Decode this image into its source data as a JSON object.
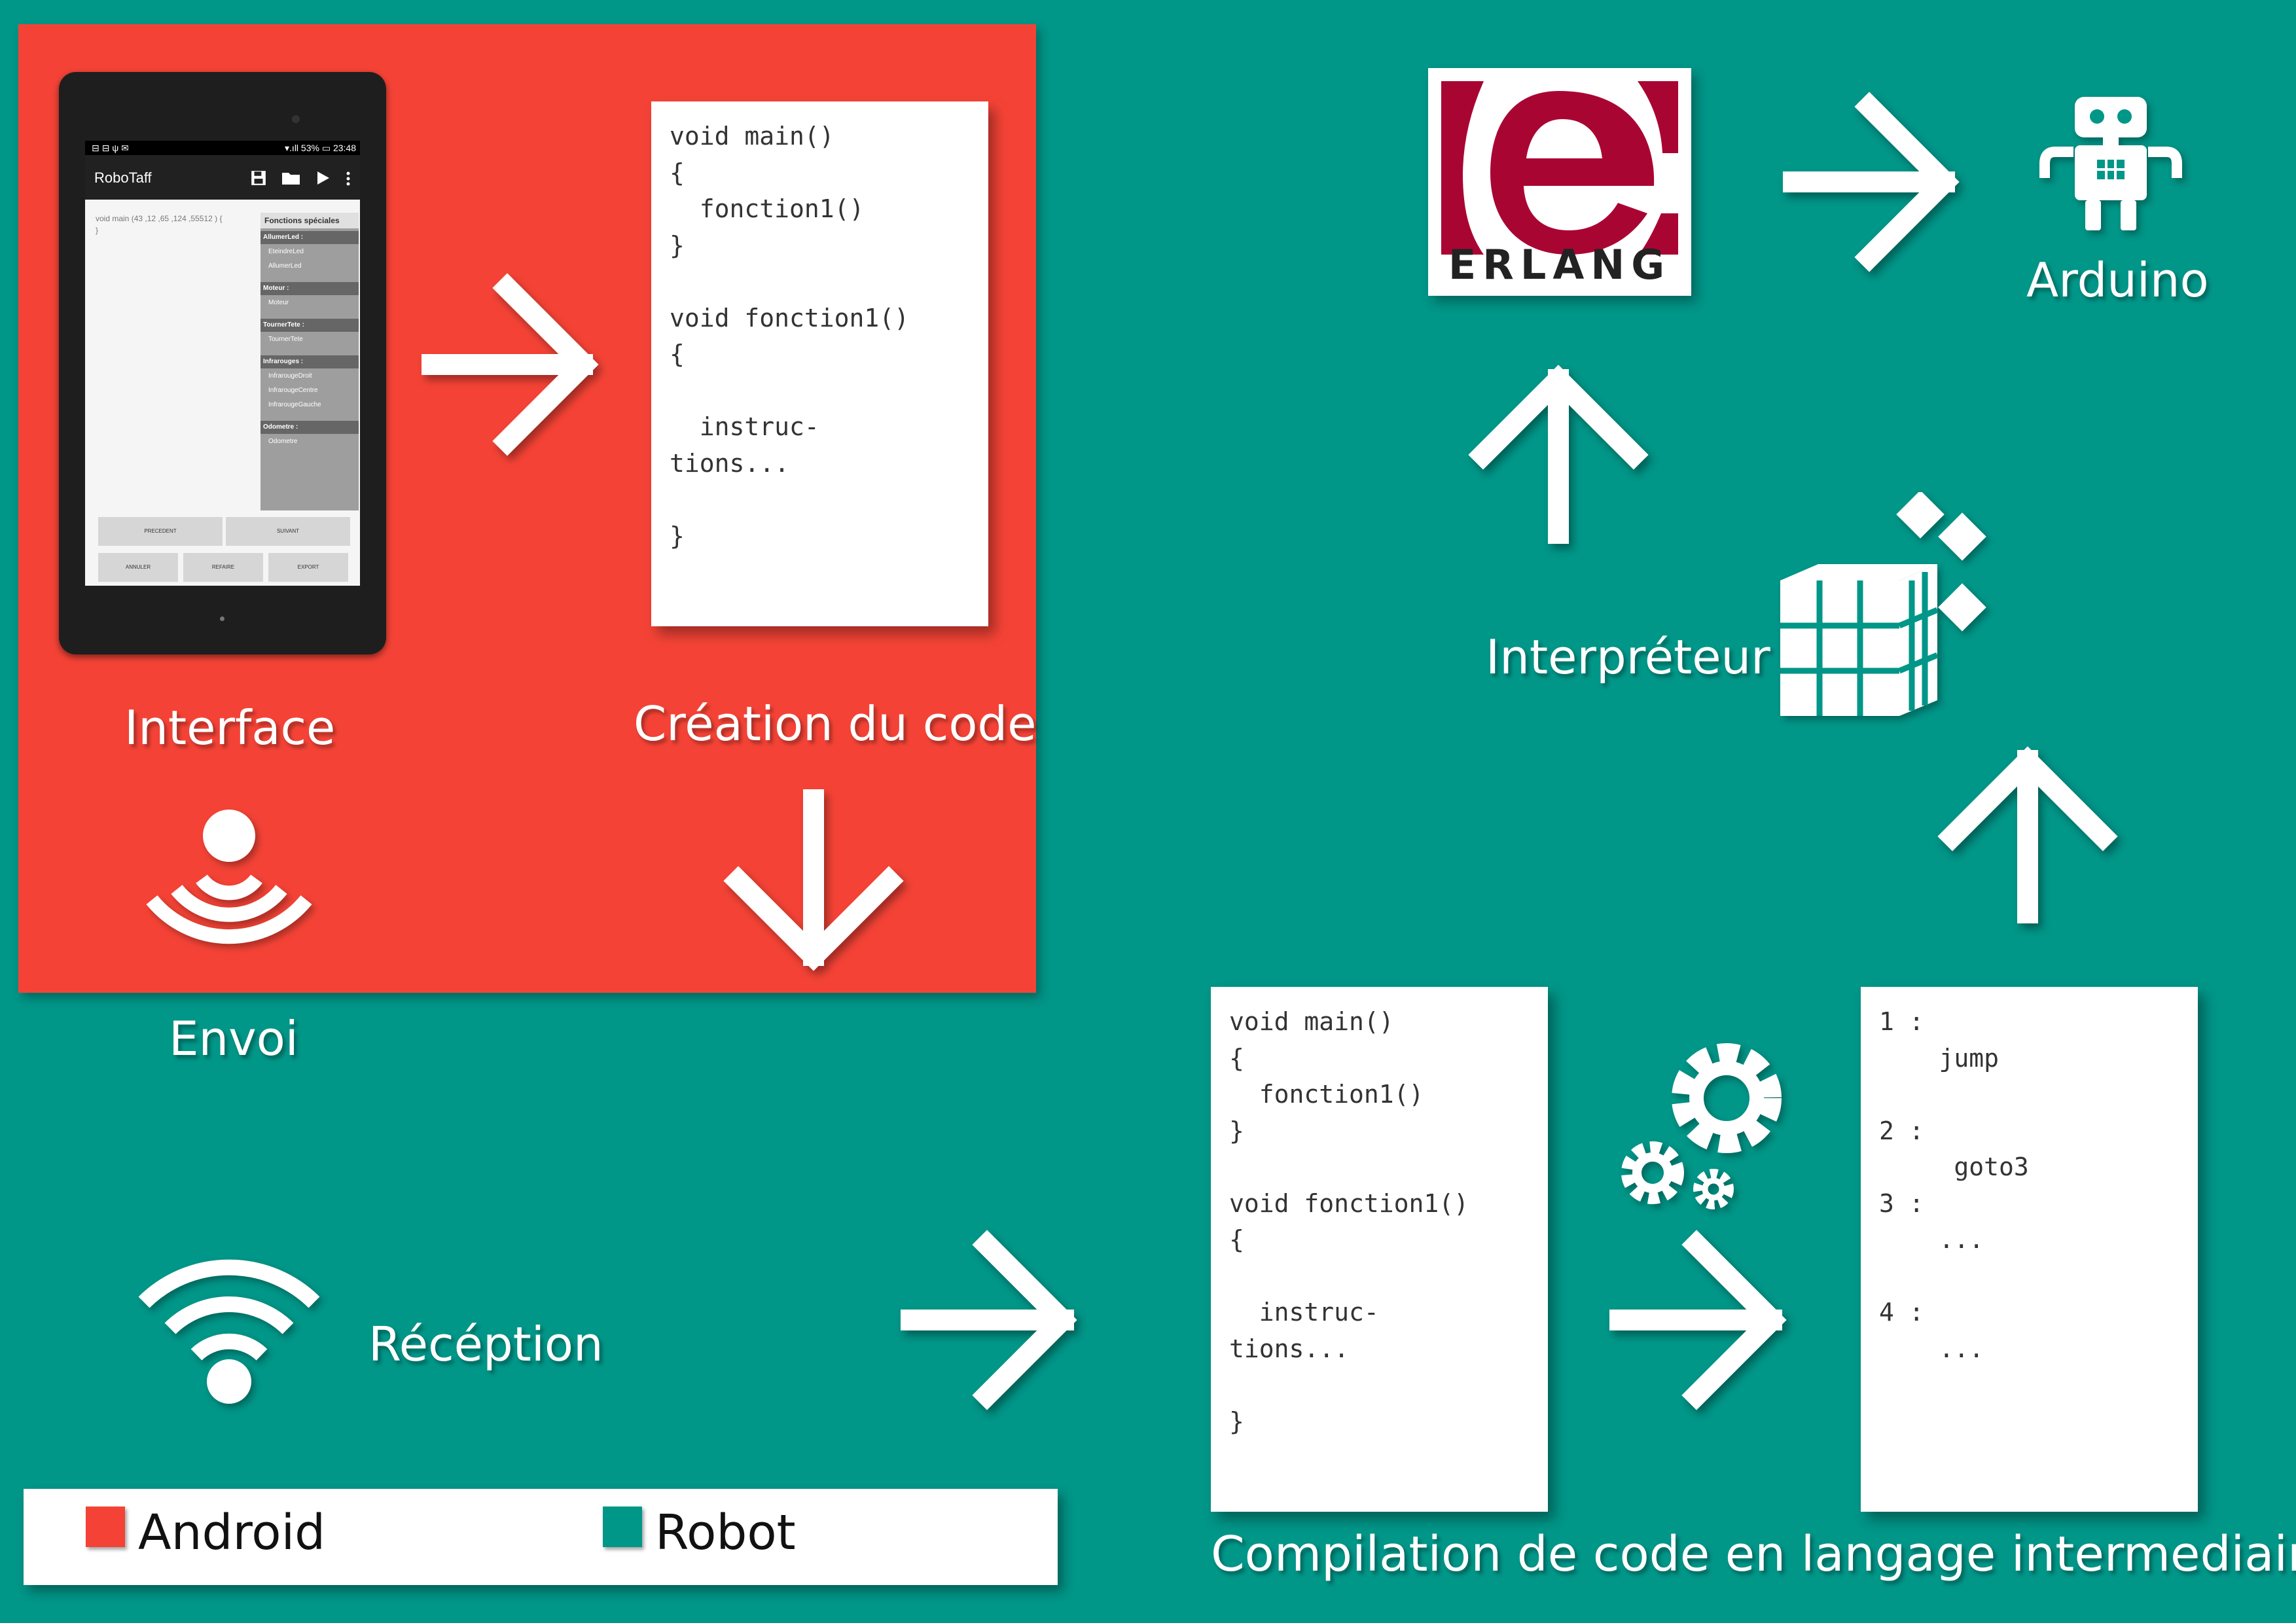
{
  "colors": {
    "background": "#009688",
    "android": "#F44336",
    "robot": "#009688",
    "white": "#FFFFFF"
  },
  "labels": {
    "interface": "Interface",
    "creation": "Création du code",
    "envoi": "Envoi",
    "reception": "Récéption",
    "compilation": "Compilation de code en langage intermediaire",
    "interpreteur": "Interpréteur",
    "arduino": "Arduino",
    "erlang": "ERLANG"
  },
  "code_source": "void main()\n{\n  fonction1()\n}\n\nvoid fonction1()\n{\n\n  instruc-\ntions...\n\n}",
  "code_intermediate": "1 :\n    jump\n\n2 :\n     goto3\n3 :\n    ...\n\n4 :\n    ...",
  "legend": {
    "android": "Android",
    "robot": "Robot"
  },
  "phone": {
    "status_icons": "⊟ ⊟ ψ ✉",
    "status_right": "▾.ıll 53% ▭ 23:48",
    "app_title": "RoboTaff",
    "editor_text": "void main (43 ,12 ,65 ,124 ,55512 ) {\n}",
    "panel_header": "Fonctions spéciales",
    "groups": [
      {
        "title": "AllumerLed :",
        "items": [
          "EteindreLed",
          "AllumerLed"
        ]
      },
      {
        "title": "Moteur :",
        "items": [
          "Moteur"
        ]
      },
      {
        "title": "TournerTete :",
        "items": [
          "TournerTete"
        ]
      },
      {
        "title": "Infrarouges :",
        "items": [
          "InfrarougeDroit",
          "InfrarougeCentre",
          "InfrarougeGauche"
        ]
      },
      {
        "title": "Odometre :",
        "items": [
          "Odometre"
        ]
      }
    ],
    "buttons_row1": [
      "PRECEDENT",
      "SUIVANT"
    ],
    "buttons_row2": [
      "ANNULER",
      "REFAIRE",
      "EXPORT"
    ]
  },
  "icons": [
    "save-icon",
    "folder-icon",
    "play-icon",
    "more-icon",
    "broadcast-icon",
    "wifi-icon",
    "gears-icon",
    "cube-grid-icon",
    "robot-icon",
    "erlang-logo"
  ]
}
